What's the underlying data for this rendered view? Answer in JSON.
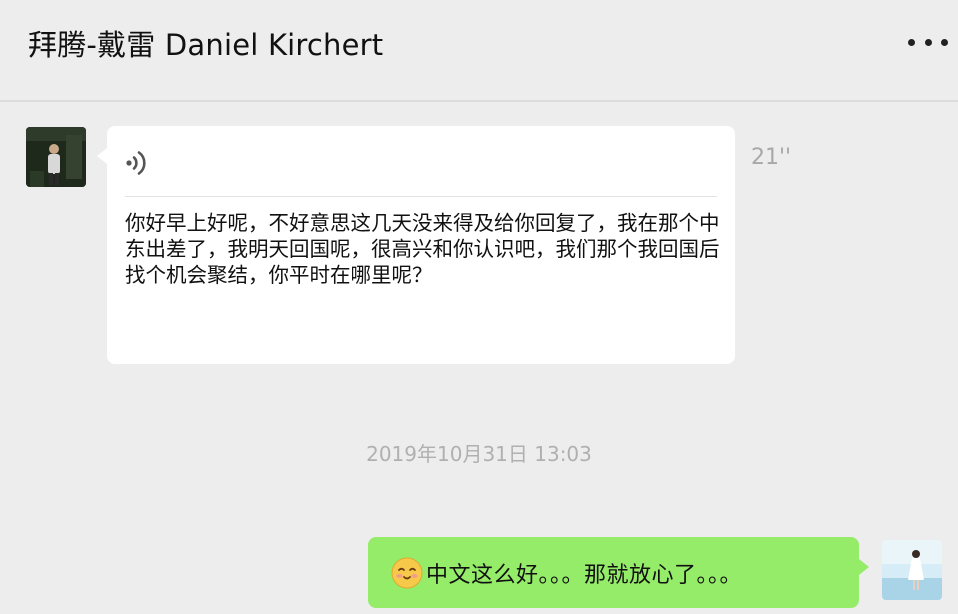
{
  "header": {
    "title": "拜腾-戴雷 Daniel Kirchert",
    "more_icon": "more-dots-icon"
  },
  "messages": {
    "incoming_voice": {
      "sender_avatar": "contact-avatar",
      "icon": "voice-wave-icon",
      "duration": "21''",
      "transcript": "你好早上好呢，不好意思这几天没来得及给你回复了，我在那个中东出差了，我明天回国呢，很高兴和你认识吧，我们那个我回国后找个机会聚结，你平时在哪里呢？"
    },
    "timestamp": "2019年10月31日 13:03",
    "outgoing_text": {
      "emoji": "smile-emoji-icon",
      "text": "中文这么好。。。那就放心了。。。"
    }
  },
  "colors": {
    "background": "#ededed",
    "incoming_bubble": "#ffffff",
    "outgoing_bubble": "#95ec69",
    "meta_text": "#b0b0b0"
  }
}
